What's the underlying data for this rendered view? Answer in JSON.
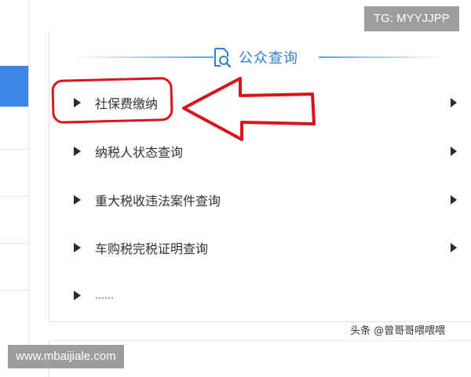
{
  "watermark": {
    "tg": "TG: MYYJJPP",
    "site": "www.mbaijiale.com"
  },
  "byline": "头条 @曾哥哥喂喂喂",
  "panel": {
    "title": "公众查询",
    "title_icon": "search-document-icon",
    "accent_color": "#2f7fd8",
    "items": [
      {
        "label": "社保费缴纳"
      },
      {
        "label": "纳税人状态查询"
      },
      {
        "label": "重大税收违法案件查询"
      },
      {
        "label": "车购税完税证明查询"
      },
      {
        "label": "……"
      }
    ]
  },
  "annotation": {
    "color": "#d8141c",
    "arrow_icon": "left-arrow-icon"
  }
}
